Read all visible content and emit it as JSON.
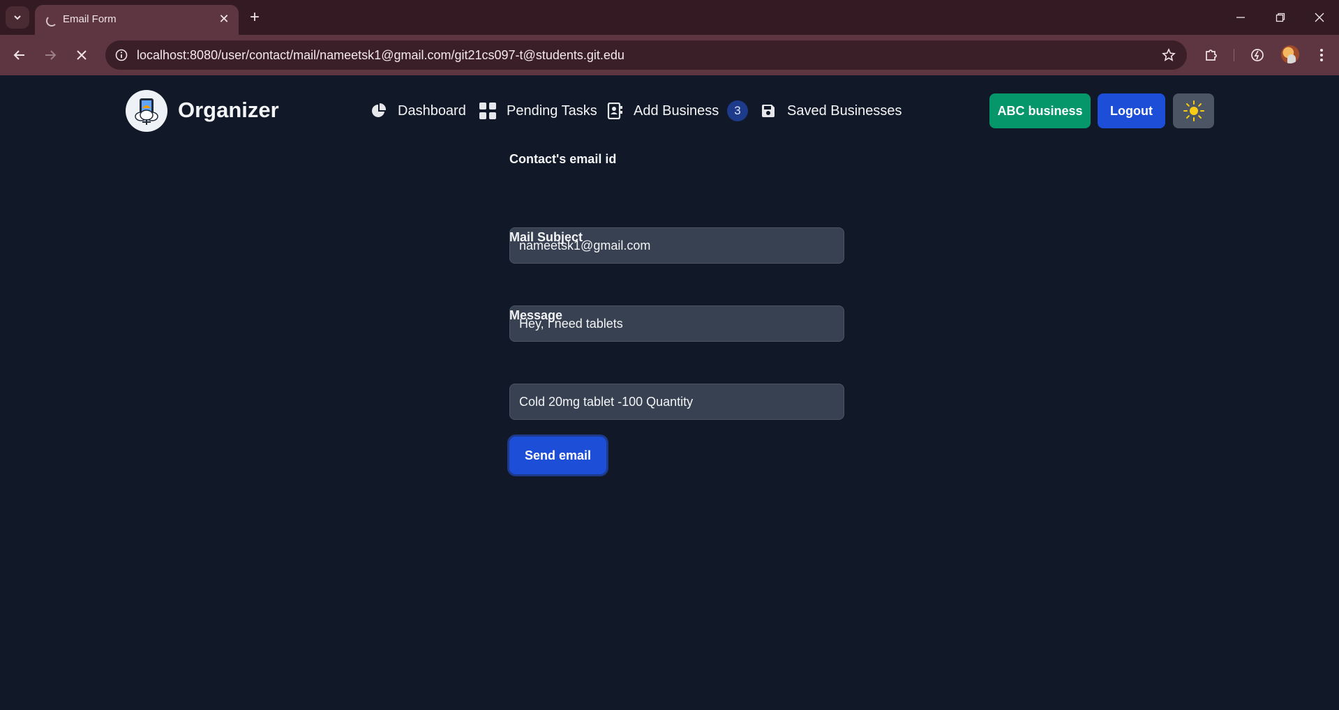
{
  "browser": {
    "tab_title": "Email Form",
    "url": "localhost:8080/user/contact/mail/nameetsk1@gmail.com/git21cs097-t@students.git.edu"
  },
  "navbar": {
    "brand": "Organizer",
    "items": [
      {
        "label": "Dashboard",
        "icon": "pie-chart-icon"
      },
      {
        "label": "Pending Tasks",
        "icon": "grid-icon"
      },
      {
        "label": "Add Business",
        "icon": "contact-card-icon"
      },
      {
        "label": "Saved Businesses",
        "icon": "floppy-disk-icon"
      }
    ],
    "badge_count": "3",
    "business_button": "ABC business",
    "logout_button": "Logout",
    "theme_toggle_icon": "sun-icon"
  },
  "form": {
    "email_label": "Contact's email id",
    "email_value": "nameetsk1@gmail.com",
    "subject_label": "Mail Subject",
    "subject_value": "Hey, I need tablets",
    "message_label": "Message",
    "message_value": "Cold 20mg tablet -100 Quantity",
    "submit_label": "Send email"
  },
  "colors": {
    "page_bg": "#111827",
    "green": "#059669",
    "blue": "#1d4ed8",
    "field_bg": "#374151"
  }
}
